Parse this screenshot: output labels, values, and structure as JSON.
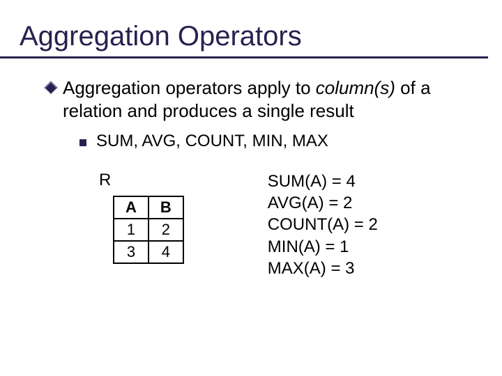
{
  "title": "Aggregation Operators",
  "lead": {
    "pre": "Aggregation operators apply to ",
    "em": "column(s)",
    "post": " of a relation and produces a single result"
  },
  "sub": "SUM, AVG, COUNT, MIN, MAX",
  "relation": {
    "name": "R",
    "headers": [
      "A",
      "B"
    ],
    "rows": [
      [
        "1",
        "2"
      ],
      [
        "3",
        "4"
      ]
    ]
  },
  "results": [
    "SUM(A) = 4",
    "AVG(A) = 2",
    "COUNT(A) = 2",
    "MIN(A) = 1",
    "MAX(A) = 3"
  ],
  "chart_data": {
    "type": "table",
    "title": "R",
    "columns": [
      "A",
      "B"
    ],
    "rows": [
      [
        1,
        2
      ],
      [
        3,
        4
      ]
    ],
    "aggregates": {
      "SUM(A)": 4,
      "AVG(A)": 2,
      "COUNT(A)": 2,
      "MIN(A)": 1,
      "MAX(A)": 3
    }
  }
}
